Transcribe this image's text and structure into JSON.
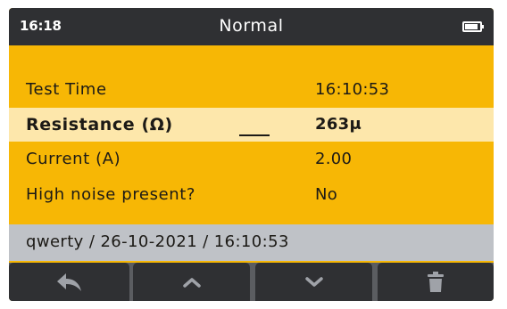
{
  "status_bar": {
    "time": "16:18",
    "title": "Normal",
    "battery_icon": "battery-icon",
    "battery_level": 0.85
  },
  "rows": [
    {
      "label": "Test Time",
      "value": "16:10:53"
    },
    {
      "label": "Resistance (Ω)",
      "value": "263μ"
    },
    {
      "label": "Current (A)",
      "value": "2.00"
    },
    {
      "label": "High noise present?",
      "value": "No"
    }
  ],
  "info_bar": {
    "text": "qwerty / 26-10-2021 / 16:10:53"
  },
  "softkeys": [
    {
      "icon": "back-arrow-icon"
    },
    {
      "icon": "chevron-up-icon"
    },
    {
      "icon": "chevron-down-icon"
    },
    {
      "icon": "trash-icon"
    }
  ],
  "colors": {
    "accent": "#f7b705",
    "highlight": "#fde7ab",
    "header": "#2f3033",
    "info_bar": "#bfc2c7"
  }
}
